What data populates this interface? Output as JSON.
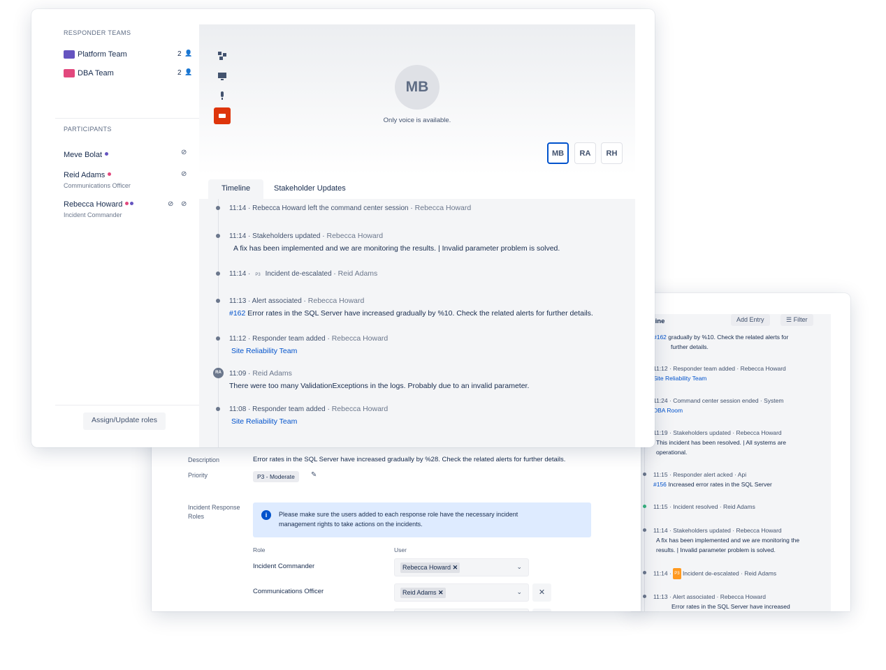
{
  "back_right": {
    "title": "line",
    "add_entry": "Add Entry",
    "filter": "Filter",
    "entries": [
      {
        "meta": "#162",
        "body_a": "gradually by %10. Check the related alerts for",
        "body_b": "further details."
      },
      {
        "meta": "11:12 · Responder team added · Rebecca Howard",
        "link": "Site Reliability Team"
      },
      {
        "meta": "11:24 · Command center session ended · System",
        "link": "DBA Room"
      },
      {
        "meta": "11:19 · Stakeholders updated · Rebecca Howard",
        "body_a": "This incident has been resolved. | All systems are",
        "body_b": "operational."
      },
      {
        "meta": "11:15 · Responder alert acked · Api",
        "link": "#156",
        "body_a": "Increased error rates in the SQL Server"
      },
      {
        "meta": "11:15 · Incident resolved · Reid Adams"
      },
      {
        "meta": "11:14 · Stakeholders updated · Rebecca Howard",
        "body_a": "A fix has been implemented and we are monitoring the",
        "body_b": "results. | Invalid parameter problem is solved."
      },
      {
        "meta_a": "11:14 ·",
        "badge": "P3",
        "meta_b": "Incident de-escalated · Reid Adams"
      },
      {
        "meta": "11:13 · Alert associated · Rebecca Howard",
        "body_a": "Error rates in the SQL Server have increased"
      }
    ]
  },
  "back_mid": {
    "description_label": "Description",
    "description": "Error rates in the SQL Server have increased gradually by %28. Check the related alerts for further details.",
    "priority_label": "Priority",
    "priority": "P3 - Moderate",
    "roles_label_a": "Incident Response",
    "roles_label_b": "Roles",
    "info_a": "Please make sure the users added to each response role have the necessary incident",
    "info_b": "management rights to take actions on the incidents.",
    "col_role": "Role",
    "col_user": "User",
    "rows": [
      {
        "role": "Incident Commander",
        "user": "Rebecca Howard"
      },
      {
        "role": "Communications Officer",
        "user": "Reid Adams"
      }
    ]
  },
  "front": {
    "responder_teams_heading": "RESPONDER TEAMS",
    "teams": [
      {
        "name": "Platform Team",
        "count": "2",
        "color": "#6554c0"
      },
      {
        "name": "DBA Team",
        "count": "2",
        "color": "#e2487d"
      }
    ],
    "participants_heading": "PARTICIPANTS",
    "participants": [
      {
        "name": "Meve Bolat",
        "role": ""
      },
      {
        "name": "Reid Adams",
        "role": "Communications Officer"
      },
      {
        "name": "Rebecca Howard",
        "role": "Incident Commander"
      }
    ],
    "assign_button": "Assign/Update roles",
    "video": {
      "avatar": "MB",
      "message": "Only voice is available.",
      "avatars": [
        "MB",
        "RA",
        "RH"
      ]
    },
    "tabs": [
      "Timeline",
      "Stakeholder Updates"
    ],
    "timeline": [
      {
        "meta": "11:14 · Rebecca Howard left the command center session ·",
        "who": "Rebecca Howard"
      },
      {
        "meta": "11:14 · Stakeholders updated ·",
        "who": "Rebecca Howard",
        "body": "A fix has been implemented and we are monitoring the results. | Invalid parameter problem is solved."
      },
      {
        "meta_a": "11:14 ·",
        "badge": "P3",
        "meta_b": "Incident de-escalated ·",
        "who": "Reid Adams"
      },
      {
        "meta": "11:13 · Alert associated ·",
        "who": "Rebecca Howard",
        "link": "#162",
        "body": "Error rates in the SQL Server have increased gradually by %10. Check the related alerts for further details."
      },
      {
        "meta": "11:12 · Responder team added ·",
        "who": "Rebecca Howard",
        "link": "Site Reliability Team"
      },
      {
        "avatar": "RA",
        "meta": "11:09 ·",
        "who": "Reid Adams",
        "body": "There were too many ValidationExceptions in the logs. Probably due to an invalid parameter."
      },
      {
        "meta": "11:08 · Responder team added ·",
        "who": "Rebecca Howard",
        "link": "Site Reliability Team"
      }
    ]
  },
  "colors": {
    "accent": "#0052cc",
    "green": "#36b37e",
    "orange": "#ff991f",
    "red": "#de350b"
  }
}
